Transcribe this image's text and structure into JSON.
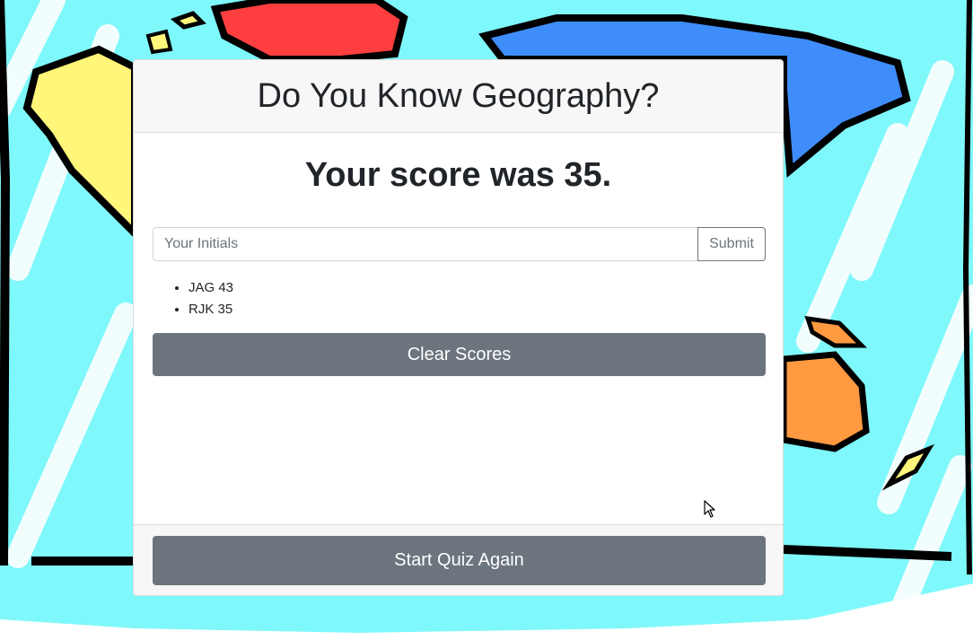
{
  "header": {
    "title": "Do You Know Geography?"
  },
  "result": {
    "score_text": "Your score was 35."
  },
  "initials_form": {
    "placeholder": "Your Initials",
    "value": "",
    "submit_label": "Submit"
  },
  "high_scores": [
    "JAG 43",
    "RJK 35"
  ],
  "buttons": {
    "clear_label": "Clear Scores",
    "restart_label": "Start Quiz Again"
  },
  "colors": {
    "button_bg": "#6c757d",
    "map_ocean": "#7ff8fb",
    "map_land_yellow": "#fff67a",
    "map_land_red": "#ff3f3f",
    "map_land_blue": "#3f8dfb",
    "map_land_orange": "#ff9a40"
  },
  "icons": {
    "cursor": "mouse-pointer-icon"
  }
}
